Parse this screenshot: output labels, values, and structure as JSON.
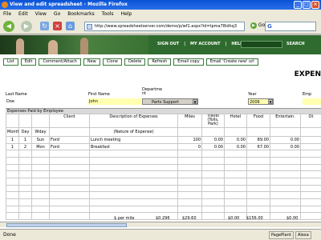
{
  "window": {
    "title": "View and edit spreadsheet - Mozilla Firefox"
  },
  "menu": [
    "File",
    "Edit",
    "View",
    "Go",
    "Bookmarks",
    "Tools",
    "Help"
  ],
  "browser": {
    "url": "http://www.spreadsheetserver.com/demo/p/wf1.aspx?id=tpma78idhq3",
    "go_label": "Go"
  },
  "banner": {
    "links": [
      "SIGN OUT",
      "MY ACCOUNT",
      "HELP"
    ],
    "separator": "|",
    "search_label": "SEARCH"
  },
  "actions": [
    "List",
    "Edit",
    "Comment/Attach",
    "New",
    "Clone",
    "Delete",
    "Refresh",
    "Email copy",
    "Email 'Create new' url"
  ],
  "sheet": {
    "title": "EXPEN",
    "labels": {
      "last_name": "Last Name",
      "first_name": "First Name",
      "department": "Departme nt",
      "year": "Year",
      "employee": "Emp"
    },
    "values": {
      "last_name": "Doe",
      "first_name": "John",
      "department": "Parts Support",
      "year": "2006"
    },
    "section": "Expenses Paid by Employee",
    "columns": {
      "month": "Month",
      "day": "Day",
      "wday": "Wday",
      "client": "Client",
      "description": "Description of Expenses",
      "nature": "(Nature of Expense)",
      "miles": "Miles",
      "travel": "Travel (Tolls, Park)",
      "hotel": "Hotel",
      "food": "Food",
      "entertain": "Entertain.",
      "other": "Ot"
    },
    "rows": [
      {
        "month": "1",
        "day": "1",
        "wday": "Sun",
        "client": "Ford",
        "description": "Lunch meeting",
        "miles": "100",
        "travel": "0.00",
        "hotel": "0.00",
        "food": "89.00",
        "entertain": "0.00"
      },
      {
        "month": "1",
        "day": "2",
        "wday": "Mon",
        "client": "Ford",
        "description": "Breakfast",
        "miles": "0",
        "travel": "0.00",
        "hotel": "0.00",
        "food": "67.00",
        "entertain": "0.00"
      }
    ],
    "footer": {
      "label": "$ per mile",
      "per_mile": "$0.296",
      "miles_total": "$29.60",
      "hotel_total": "$0.00",
      "food_total": "$156.00",
      "entertain_total": "$0.00"
    }
  },
  "status": {
    "text": "Done",
    "pageplant": "PagePlant",
    "alexa": "Alexa"
  }
}
